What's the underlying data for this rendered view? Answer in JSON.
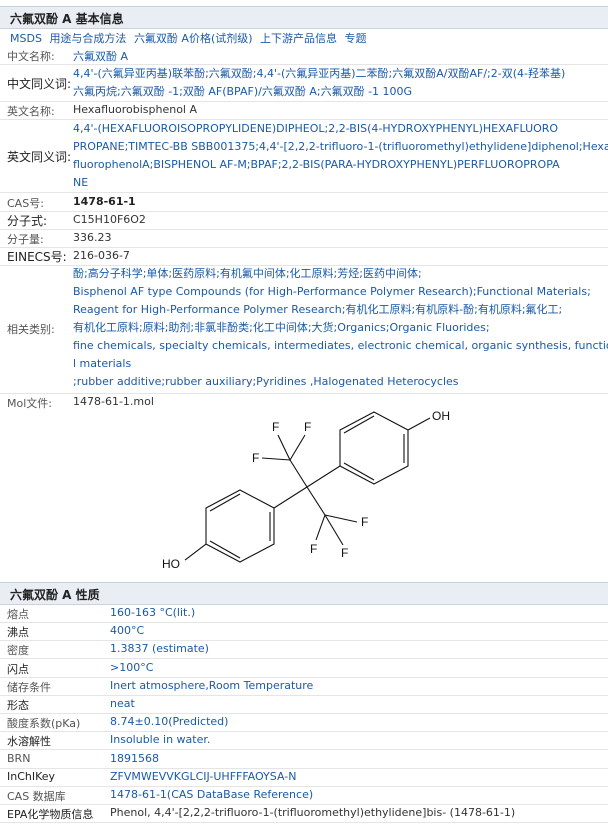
{
  "basic": {
    "title": "六氟双酚 A 基本信息",
    "links": [
      "MSDS",
      "用途与合成方法",
      "六氟双酚 A价格(试剂级)",
      "上下游产品信息",
      "专题"
    ],
    "rows": {
      "cn_name": {
        "label": "中文名称:",
        "value": "六氟双酚 A"
      },
      "cn_syn": {
        "label": "中文同义词:",
        "lines": [
          "4,4'-(六氟异亚丙基)联苯酚;六氟双酚;4,4'-(六氟异亚丙基)二苯酚;六氟双酚A/双酚AF/;2-双(4-羟苯基)",
          "六氟丙烷;六氟双酚 -1;双酚 AF(BPAF)/六氟双酚 A;六氟双酚 -1 100G"
        ]
      },
      "en_name": {
        "label": "英文名称:",
        "value": "Hexafluorobisphenol A"
      },
      "en_syn": {
        "label": "英文同义词:",
        "lines": [
          "4,4'-(HEXAFLUOROISOPROPYLIDENE)DIPHEOL;2,2-BIS(4-HYDROXYPHENYL)HEXAFLUORO",
          "PROPANE;TIMTEC-BB SBB001375;4,4'-[2,2,2-trifluoro-1-(trifluoromethyl)ethylidene]diphenol;Hexa",
          "fluorophenolA;BISPHENOL AF-M;BPAF;2,2-BIS(PARA-HYDROXYPHENYL)PERFLUOROPROPA",
          "NE"
        ]
      },
      "cas": {
        "label": "CAS号:",
        "value": "1478-61-1"
      },
      "formula": {
        "label": "分子式:",
        "value": "C15H10F6O2"
      },
      "mw": {
        "label": "分子量:",
        "value": "336.23"
      },
      "einecs": {
        "label": "EINECS号:",
        "value": "216-036-7"
      },
      "category": {
        "label": "相关类别:",
        "lines": [
          "酚;高分子科学;单体;医药原料;有机氟中间体;化工原料;芳烃;医药中间体;",
          "Bisphenol AF type Compounds (for High-Performance Polymer Research);Functional Materials;",
          "Reagent for High-Performance Polymer Research;有机化工原料;有机原料-酚;有机原料;氟化工;",
          "有机化工原料;原料;助剂;非氯非酚类;化工中间体;大货;Organics;Organic Fluorides;",
          "fine chemicals, specialty chemicals, intermediates, electronic chemical, organic synthesis, functiona",
          "l materials",
          ";rubber additive;rubber auxiliary;Pyridines ,Halogenated Heterocycles"
        ]
      },
      "mol": {
        "label": "Mol文件:",
        "value": "1478-61-1.mol"
      }
    },
    "structure": {
      "atoms": [
        "OH",
        "HO",
        "F",
        "F",
        "F",
        "F",
        "F",
        "F"
      ]
    }
  },
  "props": {
    "title": "六氟双酚 A 性质",
    "rows": [
      {
        "label": "熔点",
        "value": "160-163 °C(lit.)"
      },
      {
        "label": "沸点",
        "value": "400°C"
      },
      {
        "label": "密度",
        "value": "1.3837 (estimate)"
      },
      {
        "label": "闪点",
        "value": ">100°C"
      },
      {
        "label": "储存条件",
        "value": "Inert atmosphere,Room Temperature"
      },
      {
        "label": "形态",
        "value": "neat"
      },
      {
        "label": "酸度系数(pKa)",
        "value": "8.74±0.10(Predicted)"
      },
      {
        "label": "水溶解性",
        "value": "Insoluble in water."
      },
      {
        "label": "BRN",
        "value": "1891568"
      },
      {
        "label": "InChIKey",
        "value": "ZFVMWEVVKGLCIJ-UHFFFAOYSA-N"
      },
      {
        "label": "CAS 数据库",
        "value": "1478-61-1(CAS DataBase Reference)"
      },
      {
        "label": "EPA化学物质信息",
        "value": "Phenol, 4,4'-[2,2,2-trifluoro-1-(trifluoromethyl)ethylidene]bis- (1478-61-1)"
      }
    ]
  }
}
